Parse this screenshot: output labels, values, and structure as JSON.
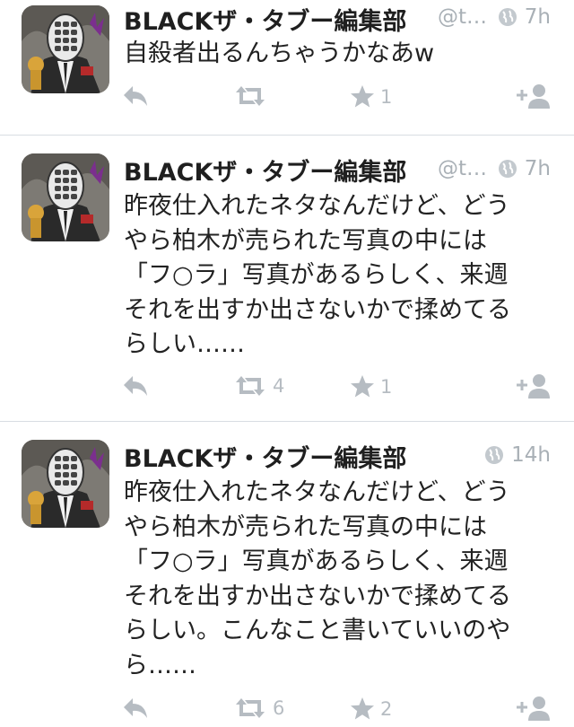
{
  "tweets": [
    {
      "name": "BLACKザ・タブー編集部",
      "handle": "@t…",
      "time": "7h",
      "text": "自殺者出るんちゃうかなあw",
      "retweets": "",
      "favorites": "1"
    },
    {
      "name": "BLACKザ・タブー編集部",
      "handle": "@t…",
      "time": "7h",
      "text": "昨夜仕入れたネタなんだけど、どう\nやら柏木が売られた写真の中には\n「フ○ラ」写真があるらしく、来週\nそれを出すか出さないかで揉めてる\nらしい……",
      "retweets": "4",
      "favorites": "1"
    },
    {
      "name": "BLACKザ・タブー編集部",
      "handle": "",
      "time": "14h",
      "text": "昨夜仕入れたネタなんだけど、どう\nやら柏木が売られた写真の中には\n「フ○ラ」写真があるらしく、来週\nそれを出すか出さないかで揉めてる\nらしい。こんなこと書いていいのや\nら……",
      "retweets": "6",
      "favorites": "2"
    }
  ],
  "colors": {
    "icon": "#b6bcc2",
    "meta": "#a9b0b6",
    "divider": "#d8dde2"
  },
  "icons": [
    "reply-icon",
    "retweet-icon",
    "star-icon",
    "follow-icon",
    "globe-icon"
  ]
}
